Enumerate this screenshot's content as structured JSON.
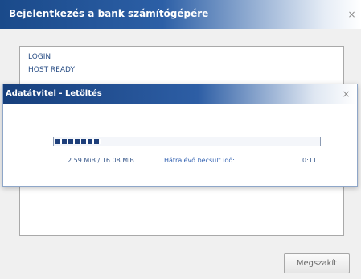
{
  "outer_window": {
    "title": "Bejelentkezés a bank számítógépére",
    "close_label": "×",
    "log_lines": [
      "LOGIN",
      "HOST READY"
    ],
    "cancel_label": "Megszakít"
  },
  "transfer_dialog": {
    "title": "Adatátvitel - Letöltés",
    "close_label": "×",
    "progress_fraction": 0.17,
    "size_text": "2.59 MiB / 16.08 MiB",
    "remaining_label": "Hátralévő becsült idő:",
    "remaining_value": "0:11"
  },
  "colors": {
    "title_blue": "#1a4a8a",
    "progress_blue": "#1e3f7a"
  },
  "icons": {
    "close": "close-icon"
  }
}
